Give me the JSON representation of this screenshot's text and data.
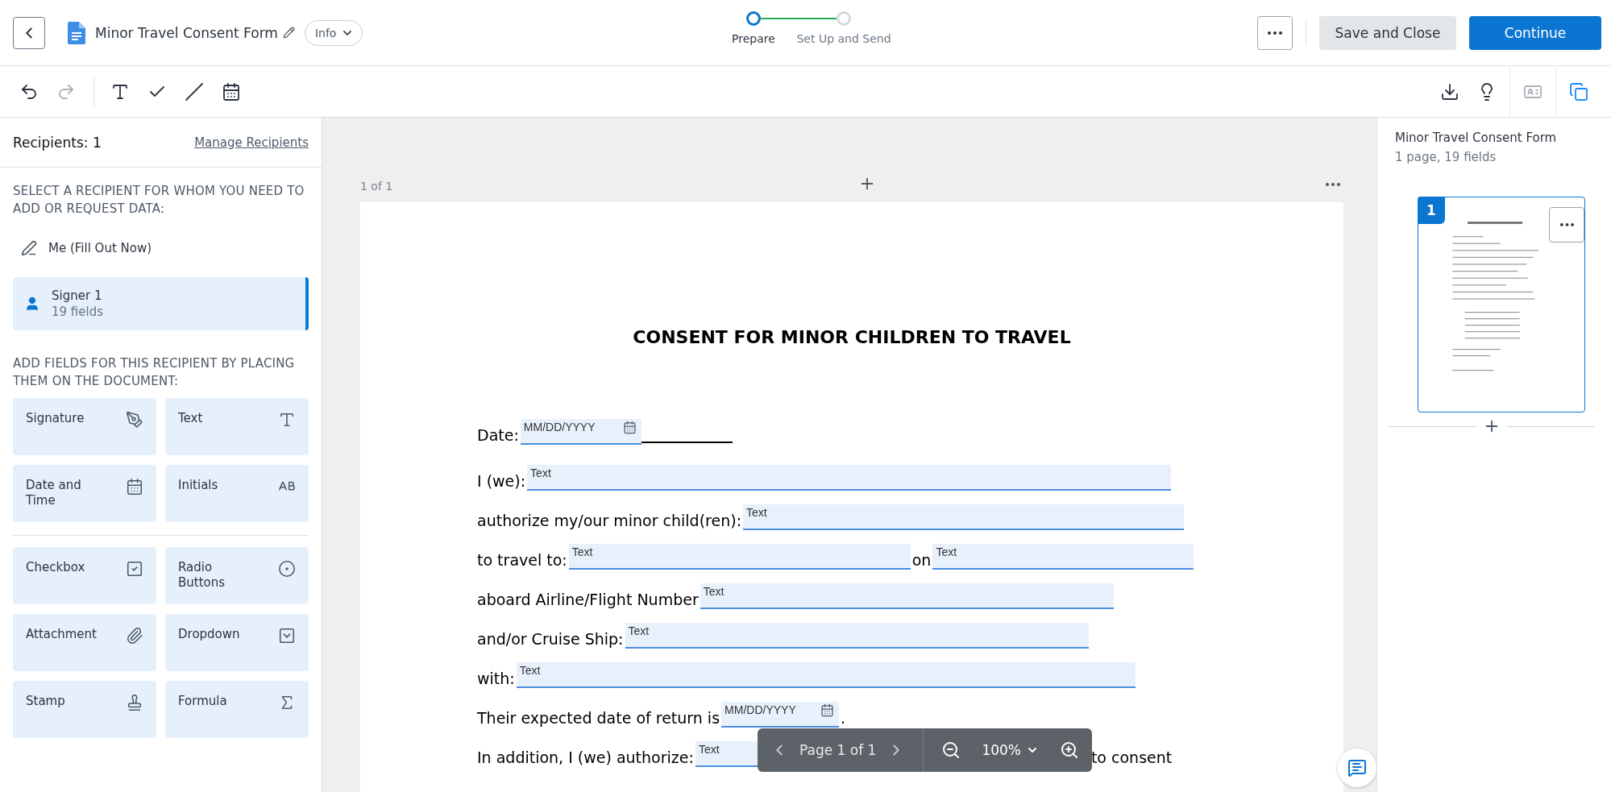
{
  "header": {
    "document_title": "Minor Travel Consent Form",
    "info_menu": "Info",
    "steps": [
      {
        "label": "Prepare",
        "selected": true
      },
      {
        "label": "Set Up and Send",
        "selected": false
      }
    ],
    "buttons": [
      {
        "kind": "secondary",
        "label": "Save and Close"
      },
      {
        "kind": "primary",
        "label": "Continue"
      }
    ]
  },
  "toolbar": {
    "history": [
      {
        "kind": "undo",
        "disabled": false
      },
      {
        "kind": "redo",
        "disabled": true
      }
    ],
    "tools": [
      {
        "kind": "text",
        "disabled": false
      },
      {
        "kind": "check",
        "disabled": false
      },
      {
        "kind": "line",
        "disabled": false
      },
      {
        "kind": "date",
        "disabled": false
      }
    ],
    "right_tools": [
      {
        "kind": "download",
        "disabled": false,
        "active": false
      },
      {
        "kind": "tip",
        "disabled": false,
        "active": false
      },
      {
        "kind": "field-settings",
        "disabled": true,
        "active": false
      },
      {
        "kind": "pages",
        "disabled": false,
        "active": true
      }
    ]
  },
  "recipients": {
    "title": "Recipients: 1",
    "manage_link": "Manage Recipients",
    "select_heading": "SELECT A RECIPIENT FOR WHOM YOU NEED TO ADD OR REQUEST DATA:",
    "items": [
      {
        "kind": "self",
        "name": "Me (Fill Out Now)",
        "selected": false
      },
      {
        "kind": "signer",
        "name": "Signer 1",
        "detail": "19 fields",
        "selected": true
      }
    ],
    "fields_heading": "ADD FIELDS FOR THIS RECIPIENT BY PLACING THEM ON THE DOCUMENT:",
    "field_groups": [
      [
        {
          "kind": "signature",
          "label": "Signature"
        },
        {
          "kind": "text",
          "label": "Text"
        },
        {
          "kind": "date",
          "label": "Date and Time"
        },
        {
          "kind": "initials",
          "label": "Initials"
        }
      ],
      [
        {
          "kind": "checkbox",
          "label": "Checkbox"
        },
        {
          "kind": "radio",
          "label": "Radio Buttons"
        },
        {
          "kind": "attachment",
          "label": "Attachment"
        },
        {
          "kind": "dropdown",
          "label": "Dropdown"
        },
        {
          "kind": "stamp",
          "label": "Stamp"
        },
        {
          "kind": "formula",
          "label": "Formula"
        }
      ]
    ]
  },
  "document": {
    "page_counter": "1 of 1",
    "title": "CONSENT FOR MINOR CHILDREN TO TRAVEL",
    "lines": [
      {
        "parts": [
          {
            "kind": "label",
            "text": "Date:"
          },
          {
            "kind": "date",
            "placeholder": "MM/DD/YYYY"
          },
          {
            "kind": "blank"
          }
        ]
      },
      {
        "parts": [
          {
            "kind": "label",
            "text": "I (we):"
          },
          {
            "kind": "text",
            "placeholder": "Text"
          }
        ]
      },
      {
        "parts": [
          {
            "kind": "label",
            "text": "authorize my/our minor child(ren):"
          },
          {
            "kind": "text",
            "placeholder": "Text"
          }
        ]
      },
      {
        "parts": [
          {
            "kind": "label",
            "text": "to travel to:"
          },
          {
            "kind": "text",
            "placeholder": "Text"
          },
          {
            "kind": "label",
            "text": "on"
          },
          {
            "kind": "text",
            "placeholder": "Text"
          }
        ]
      },
      {
        "parts": [
          {
            "kind": "label",
            "text": "aboard Airline/Flight Number"
          },
          {
            "kind": "text",
            "placeholder": "Text"
          }
        ]
      },
      {
        "parts": [
          {
            "kind": "label",
            "text": "and/or Cruise Ship:"
          },
          {
            "kind": "text",
            "placeholder": "Text"
          }
        ]
      },
      {
        "parts": [
          {
            "kind": "label",
            "text": "with:"
          },
          {
            "kind": "text",
            "placeholder": "Text"
          }
        ]
      },
      {
        "parts": [
          {
            "kind": "label",
            "text": "Their expected date of return is"
          },
          {
            "kind": "date",
            "placeholder": "MM/DD/YYYY"
          },
          {
            "kind": "label",
            "text": "."
          }
        ]
      },
      {
        "parts": [
          {
            "kind": "label",
            "text": "In addition, I (we) authorize:"
          },
          {
            "kind": "text",
            "placeholder": "Text"
          },
          {
            "kind": "label",
            "text": "to consent"
          }
        ]
      }
    ]
  },
  "pager": {
    "page_label": "Page 1 of 1",
    "zoom": "100%"
  },
  "pages_panel": {
    "title": "Minor Travel Consent Form",
    "summary": "1 page, 19 fields",
    "pages": [
      {
        "number": "1",
        "selected": true
      }
    ]
  }
}
